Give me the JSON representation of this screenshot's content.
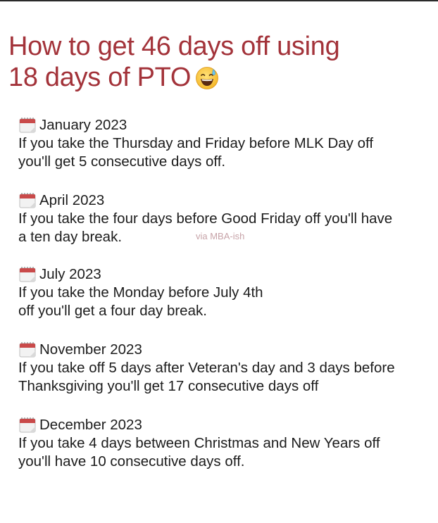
{
  "title": {
    "line1": "How to get 46 days off using",
    "line2": "18 days of PTO",
    "emoji_icon": "sweat-smile-emoji"
  },
  "watermark": "via MBA-ish",
  "colors": {
    "title": "#a3333a",
    "body_text": "#1c1c1c",
    "calendar_header": "#c94a4a"
  },
  "sections": [
    {
      "icon": "calendar-icon",
      "month": "January 2023",
      "lines": [
        "If you take the Thursday and Friday before MLK Day off",
        "you'll get 5 consecutive days off."
      ]
    },
    {
      "icon": "calendar-icon",
      "month": "April 2023",
      "lines": [
        "If you take the four days before Good Friday off you'll have",
        "a ten day break."
      ]
    },
    {
      "icon": "calendar-icon",
      "month": "July 2023",
      "lines": [
        "If you take the Monday before July 4th",
        "off you'll get a four day break."
      ]
    },
    {
      "icon": "calendar-icon",
      "month": "November 2023",
      "lines": [
        "If you take off 5 days after Veteran's day and 3 days before",
        "Thanksgiving you'll get 17 consecutive days off"
      ]
    },
    {
      "icon": "calendar-icon",
      "month": "December 2023",
      "lines": [
        "If you take 4 days between Christmas and New Years off",
        "you'll have 10 consecutive days off."
      ]
    }
  ]
}
